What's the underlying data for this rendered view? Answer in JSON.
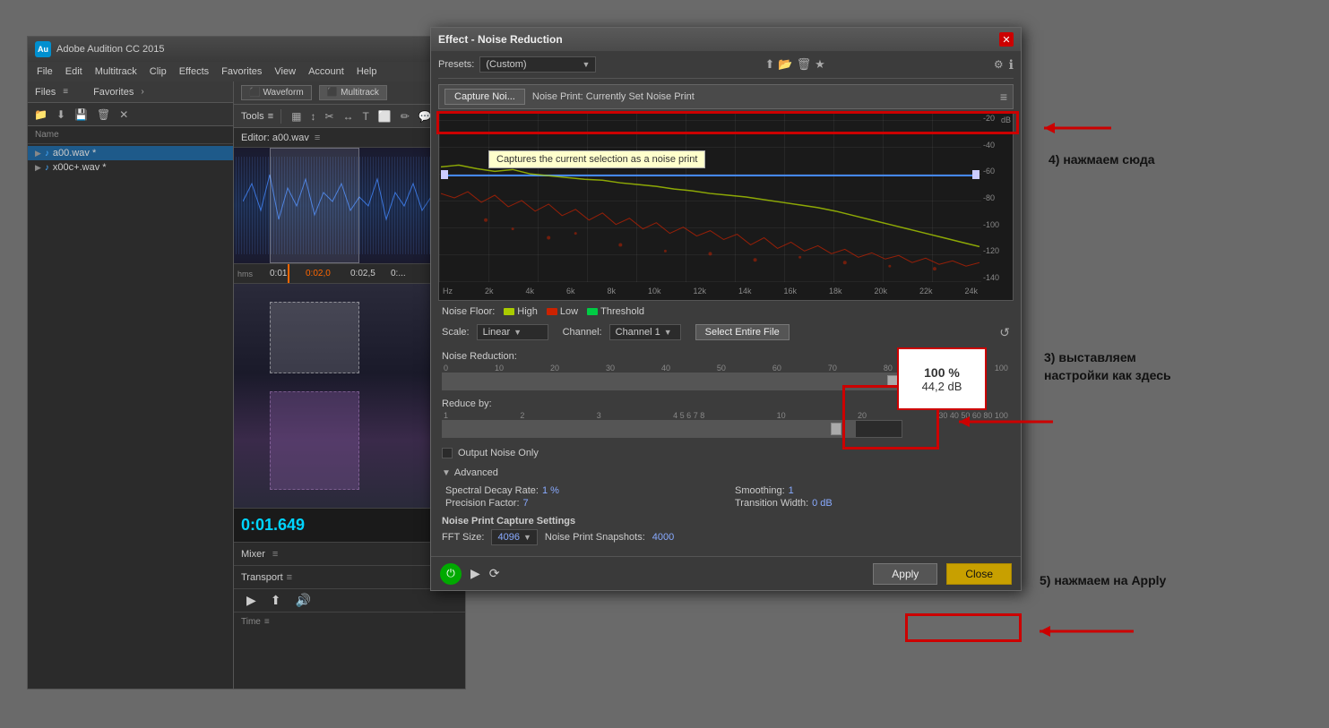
{
  "audition": {
    "title": "Adobe Audition CC 2015",
    "menu": [
      "File",
      "Edit",
      "Multitrack",
      "Clip",
      "Effects",
      "Favorites",
      "View",
      "Account",
      "Help"
    ],
    "left_panel": {
      "files_label": "Files",
      "favorites_label": "Favorites",
      "tools_label": "Tools",
      "col_name": "Name",
      "files": [
        {
          "name": "a00.wav *",
          "active": true
        },
        {
          "name": "x00c+.wav *",
          "active": false
        }
      ]
    },
    "waveform_label": "Waveform",
    "multitrack_label": "Multitrack",
    "editor_label": "Editor: a00.wav",
    "timecode": "0:01.649",
    "mixer_label": "Mixer",
    "transport_label": "Transport",
    "time_label": "Time"
  },
  "dialog": {
    "title": "Effect - Noise Reduction",
    "presets_label": "Presets:",
    "presets_value": "(Custom)",
    "capture_btn": "Capture Noi...",
    "noise_print_label": "Noise Print: Currently Set Noise Print",
    "tooltip": "Captures the current selection as a noise print",
    "noise_floor_label": "Noise Floor:",
    "legend": [
      {
        "label": "High",
        "color": "#aacc00"
      },
      {
        "label": "Low",
        "color": "#cc2200"
      },
      {
        "label": "Threshold",
        "color": "#00cc44"
      }
    ],
    "scale_label": "Scale:",
    "scale_value": "Linear",
    "channel_label": "Channel:",
    "channel_value": "Channel 1",
    "select_entire_btn": "Select Entire File",
    "noise_reduction_label": "Noise Reduction:",
    "nr_ticks": [
      "0",
      "10",
      "20",
      "30",
      "40",
      "50",
      "60",
      "70",
      "80",
      "90",
      "100"
    ],
    "nr_value_pct": "100 %",
    "nr_value_db": "44,2 dB",
    "reduce_by_label": "Reduce by:",
    "reduce_ticks": [
      "1",
      "2",
      "3",
      "4 5 6 7 8",
      "10",
      "20",
      "30 40 50 60 80 100"
    ],
    "output_noise_label": "Output Noise Only",
    "advanced_label": "Advanced",
    "spectral_decay_label": "Spectral Decay Rate:",
    "spectral_decay_value": "1 %",
    "smoothing_label": "Smoothing:",
    "smoothing_value": "1",
    "precision_label": "Precision Factor:",
    "precision_value": "7",
    "transition_label": "Transition Width:",
    "transition_value": "0 dB",
    "npc_label": "Noise Print Capture Settings",
    "fft_label": "FFT Size:",
    "fft_value": "4096",
    "snapshots_label": "Noise Print Snapshots:",
    "snapshots_value": "4000",
    "apply_btn": "Apply",
    "close_btn": "Close",
    "hz_labels": [
      "Hz",
      "2k",
      "4k",
      "6k",
      "8k",
      "10k",
      "12k",
      "14k",
      "16k",
      "18k",
      "20k",
      "22k",
      "24k"
    ],
    "db_labels": [
      "-20",
      "-40",
      "-60",
      "-80",
      "-100",
      "-120",
      "-140"
    ]
  },
  "annotations": {
    "step4": "4) нажмаем сюда",
    "step3_line1": "3) выставляем",
    "step3_line2": "настройки как здесь",
    "step5": "5) нажмаем на Apply"
  }
}
